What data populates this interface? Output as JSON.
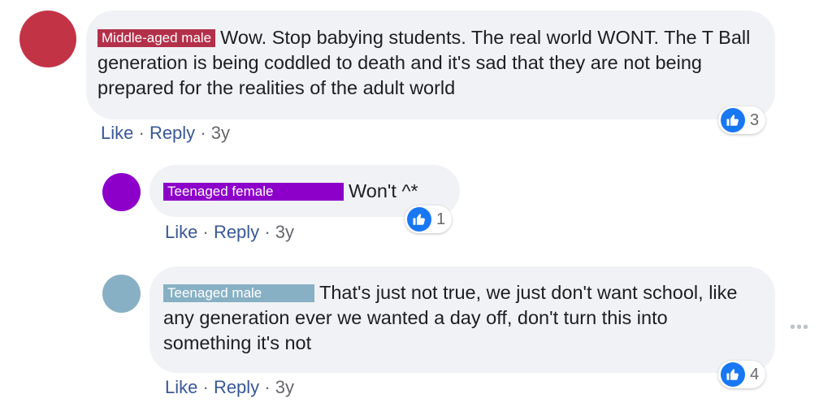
{
  "comments": [
    {
      "label": "Middle-aged male",
      "label_color": "#b3304a",
      "avatar_color": "#c33346",
      "text": "Wow. Stop babying students. The real world WONT. The T Ball generation is being coddled to death and it's sad that they are not being prepared for the realities of the adult world",
      "like_label": "Like",
      "reply_label": "Reply",
      "separator": "·",
      "time": "3y",
      "reaction_count": "3"
    },
    {
      "label": "Teenaged female",
      "label_color": "#8d00c9",
      "avatar_color": "#8d00c9",
      "text": "Won't ^*",
      "like_label": "Like",
      "reply_label": "Reply",
      "separator": "·",
      "time": "3y",
      "reaction_count": "1"
    },
    {
      "label": "Teenaged male",
      "label_color": "#87b0c4",
      "avatar_color": "#88b0c5",
      "text": "That's just not true, we just don't want school, like any generation ever we wanted a day off, don't turn this into something it's not",
      "like_label": "Like",
      "reply_label": "Reply",
      "separator": "·",
      "time": "3y",
      "reaction_count": "4"
    }
  ],
  "more_options": "•••",
  "colors": {
    "bubble": "#f0f2f5",
    "link": "#385898",
    "meta": "#65676b",
    "like_blue": "#1877f2"
  }
}
